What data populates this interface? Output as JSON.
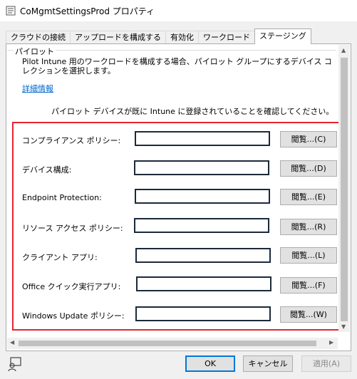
{
  "window": {
    "title": "CoMgmtSettingsProd プロパティ"
  },
  "tabs": [
    {
      "label": "クラウドの接続"
    },
    {
      "label": "アップロードを構成する"
    },
    {
      "label": "有効化"
    },
    {
      "label": "ワークロード"
    },
    {
      "label": "ステージング"
    }
  ],
  "pilot": {
    "group_label": "パイロット",
    "description": "Pilot Intune 用のワークロードを構成する場合、パイロット グループにするデバイス コレクションを選択します。",
    "more_info_link": "詳細情報",
    "confirm_text": "パイロット デバイスが既に Intune に登録されていることを確認してください。"
  },
  "rows": [
    {
      "label": "コンプライアンス ポリシー:",
      "value": "",
      "button": "閲覧...(C)"
    },
    {
      "label": "デバイス構成:",
      "value": "",
      "button": "閲覧...(D)"
    },
    {
      "label": "Endpoint Protection:",
      "value": "",
      "button": "閲覧...(E)"
    },
    {
      "label": "リソース アクセス ポリシー:",
      "value": "",
      "button": "閲覧...(R)"
    },
    {
      "label": "クライアント アプリ:",
      "value": "",
      "button": "閲覧...(L)"
    },
    {
      "label": "Office クイック実行アプリ:",
      "value": "",
      "button": "閲覧...(F)"
    },
    {
      "label": "Windows Update ポリシー:",
      "value": "",
      "button": "閲覧...(W)"
    }
  ],
  "footer": {
    "ok": "OK",
    "cancel": "キャンセル",
    "apply": "適用(A)"
  },
  "icons": {
    "app": "properties-window-icon",
    "bottom": "user-help-icon"
  },
  "colors": {
    "highlight": "#e5242b",
    "link": "#0066cc",
    "default_button_border": "#0078d7"
  }
}
